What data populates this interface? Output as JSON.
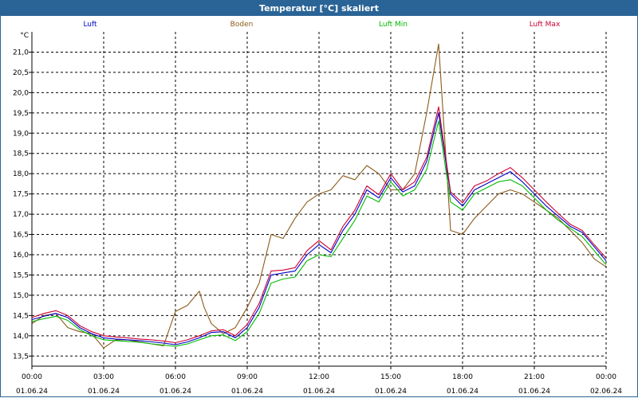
{
  "window": {
    "title": "Temperatur [°C] skaliert"
  },
  "chart_data": {
    "type": "line",
    "title": "Temperatur [°C] skaliert",
    "ylabel": "°C",
    "xlabel": "",
    "ylim": [
      13.25,
      21.5
    ],
    "xlim": [
      0,
      24
    ],
    "grid": true,
    "legend_position": "top",
    "y_ticks": [
      "13,5",
      "14,0",
      "14,5",
      "15,0",
      "15,5",
      "16,0",
      "16,5",
      "17,0",
      "17,5",
      "18,0",
      "18,5",
      "19,0",
      "19,5",
      "20,0",
      "20,5",
      "21,0"
    ],
    "x_ticks": [
      {
        "time": "00:00",
        "date": "01.06.24"
      },
      {
        "time": "03:00",
        "date": "01.06.24"
      },
      {
        "time": "06:00",
        "date": "01.06.24"
      },
      {
        "time": "09:00",
        "date": "01.06.24"
      },
      {
        "time": "12:00",
        "date": "01.06.24"
      },
      {
        "time": "15:00",
        "date": "01.06.24"
      },
      {
        "time": "18:00",
        "date": "01.06.24"
      },
      {
        "time": "21:00",
        "date": "01.06.24"
      },
      {
        "time": "00:00",
        "date": "02.06.24"
      }
    ],
    "series": [
      {
        "name": "Luft",
        "color": "#0000cc",
        "x": [
          0,
          0.5,
          1,
          1.5,
          2,
          2.5,
          3,
          3.5,
          4,
          4.5,
          5,
          5.5,
          6,
          6.5,
          7,
          7.5,
          8,
          8.5,
          9,
          9.5,
          10,
          10.5,
          11,
          11.5,
          12,
          12.5,
          13,
          13.5,
          14,
          14.5,
          15,
          15.5,
          16,
          16.5,
          17,
          17.5,
          18,
          18.5,
          19,
          19.5,
          20,
          20.5,
          21,
          21.5,
          22,
          22.5,
          23,
          23.5,
          24
        ],
        "values": [
          14.4,
          14.48,
          14.55,
          14.45,
          14.2,
          14.05,
          13.95,
          13.92,
          13.9,
          13.88,
          13.85,
          13.82,
          13.78,
          13.85,
          13.95,
          14.08,
          14.1,
          13.95,
          14.2,
          14.7,
          15.5,
          15.55,
          15.6,
          16.0,
          16.25,
          16.05,
          16.6,
          17.0,
          17.6,
          17.4,
          17.9,
          17.55,
          17.7,
          18.3,
          19.5,
          17.5,
          17.2,
          17.6,
          17.75,
          17.9,
          18.05,
          17.8,
          17.5,
          17.2,
          16.95,
          16.7,
          16.55,
          16.2,
          15.85
        ]
      },
      {
        "name": "Boden",
        "color": "#8b5a1a",
        "x": [
          0,
          0.5,
          1,
          1.5,
          2,
          2.5,
          3,
          3.5,
          4,
          4.5,
          5,
          5.5,
          6,
          6.5,
          7,
          7.2,
          7.5,
          8,
          8.5,
          9,
          9.5,
          10,
          10.5,
          11,
          11.5,
          12,
          12.5,
          13,
          13.5,
          14,
          14.5,
          15,
          15.5,
          16,
          16.5,
          17,
          17.5,
          18,
          18.5,
          19,
          19.5,
          20,
          20.5,
          21,
          21.5,
          22,
          22.5,
          23,
          23.5,
          24
        ],
        "values": [
          14.3,
          14.5,
          14.55,
          14.2,
          14.1,
          14.05,
          13.7,
          13.9,
          13.9,
          13.85,
          13.8,
          13.75,
          14.6,
          14.75,
          15.1,
          14.7,
          14.3,
          14.05,
          14.2,
          14.7,
          15.3,
          16.5,
          16.4,
          16.9,
          17.3,
          17.5,
          17.6,
          17.95,
          17.85,
          18.2,
          18.0,
          17.6,
          17.6,
          18.0,
          19.5,
          21.2,
          16.6,
          16.5,
          16.9,
          17.2,
          17.5,
          17.6,
          17.5,
          17.3,
          17.1,
          16.9,
          16.6,
          16.3,
          15.9,
          15.7
        ]
      },
      {
        "name": "Luft Min",
        "color": "#00bb00",
        "x": [
          0,
          0.5,
          1,
          1.5,
          2,
          2.5,
          3,
          3.5,
          4,
          4.5,
          5,
          5.5,
          6,
          6.5,
          7,
          7.5,
          8,
          8.5,
          9,
          9.5,
          10,
          10.5,
          11,
          11.5,
          12,
          12.5,
          13,
          13.5,
          14,
          14.5,
          15,
          15.5,
          16,
          16.5,
          17,
          17.5,
          18,
          18.5,
          19,
          19.5,
          20,
          20.5,
          21,
          21.5,
          22,
          22.5,
          23,
          23.5,
          24
        ],
        "values": [
          14.35,
          14.42,
          14.48,
          14.38,
          14.15,
          14.0,
          13.9,
          13.88,
          13.86,
          13.84,
          13.8,
          13.77,
          13.74,
          13.8,
          13.9,
          14.0,
          14.02,
          13.88,
          14.1,
          14.55,
          15.3,
          15.4,
          15.45,
          15.85,
          16.0,
          15.95,
          16.4,
          16.85,
          17.45,
          17.3,
          17.8,
          17.45,
          17.6,
          18.1,
          19.3,
          17.3,
          17.1,
          17.5,
          17.65,
          17.8,
          17.85,
          17.7,
          17.4,
          17.1,
          16.85,
          16.65,
          16.45,
          16.1,
          15.75
        ]
      },
      {
        "name": "Luft Max",
        "color": "#cc0033",
        "x": [
          0,
          0.5,
          1,
          1.5,
          2,
          2.5,
          3,
          3.5,
          4,
          4.5,
          5,
          5.5,
          6,
          6.5,
          7,
          7.5,
          8,
          8.5,
          9,
          9.5,
          10,
          10.5,
          11,
          11.5,
          12,
          12.5,
          13,
          13.5,
          14,
          14.5,
          15,
          15.5,
          16,
          16.5,
          17,
          17.5,
          18,
          18.5,
          19,
          19.5,
          20,
          20.5,
          21,
          21.5,
          22,
          22.5,
          23,
          23.5,
          24
        ],
        "values": [
          14.45,
          14.55,
          14.62,
          14.5,
          14.25,
          14.1,
          14.0,
          13.97,
          13.95,
          13.92,
          13.9,
          13.87,
          13.83,
          13.9,
          14.0,
          14.12,
          14.15,
          14.0,
          14.28,
          14.8,
          15.6,
          15.62,
          15.68,
          16.1,
          16.35,
          16.12,
          16.7,
          17.1,
          17.7,
          17.48,
          18.0,
          17.6,
          17.8,
          18.4,
          19.65,
          17.55,
          17.28,
          17.7,
          17.82,
          18.0,
          18.15,
          17.9,
          17.6,
          17.3,
          17.02,
          16.75,
          16.6,
          16.25,
          15.92
        ]
      }
    ]
  }
}
